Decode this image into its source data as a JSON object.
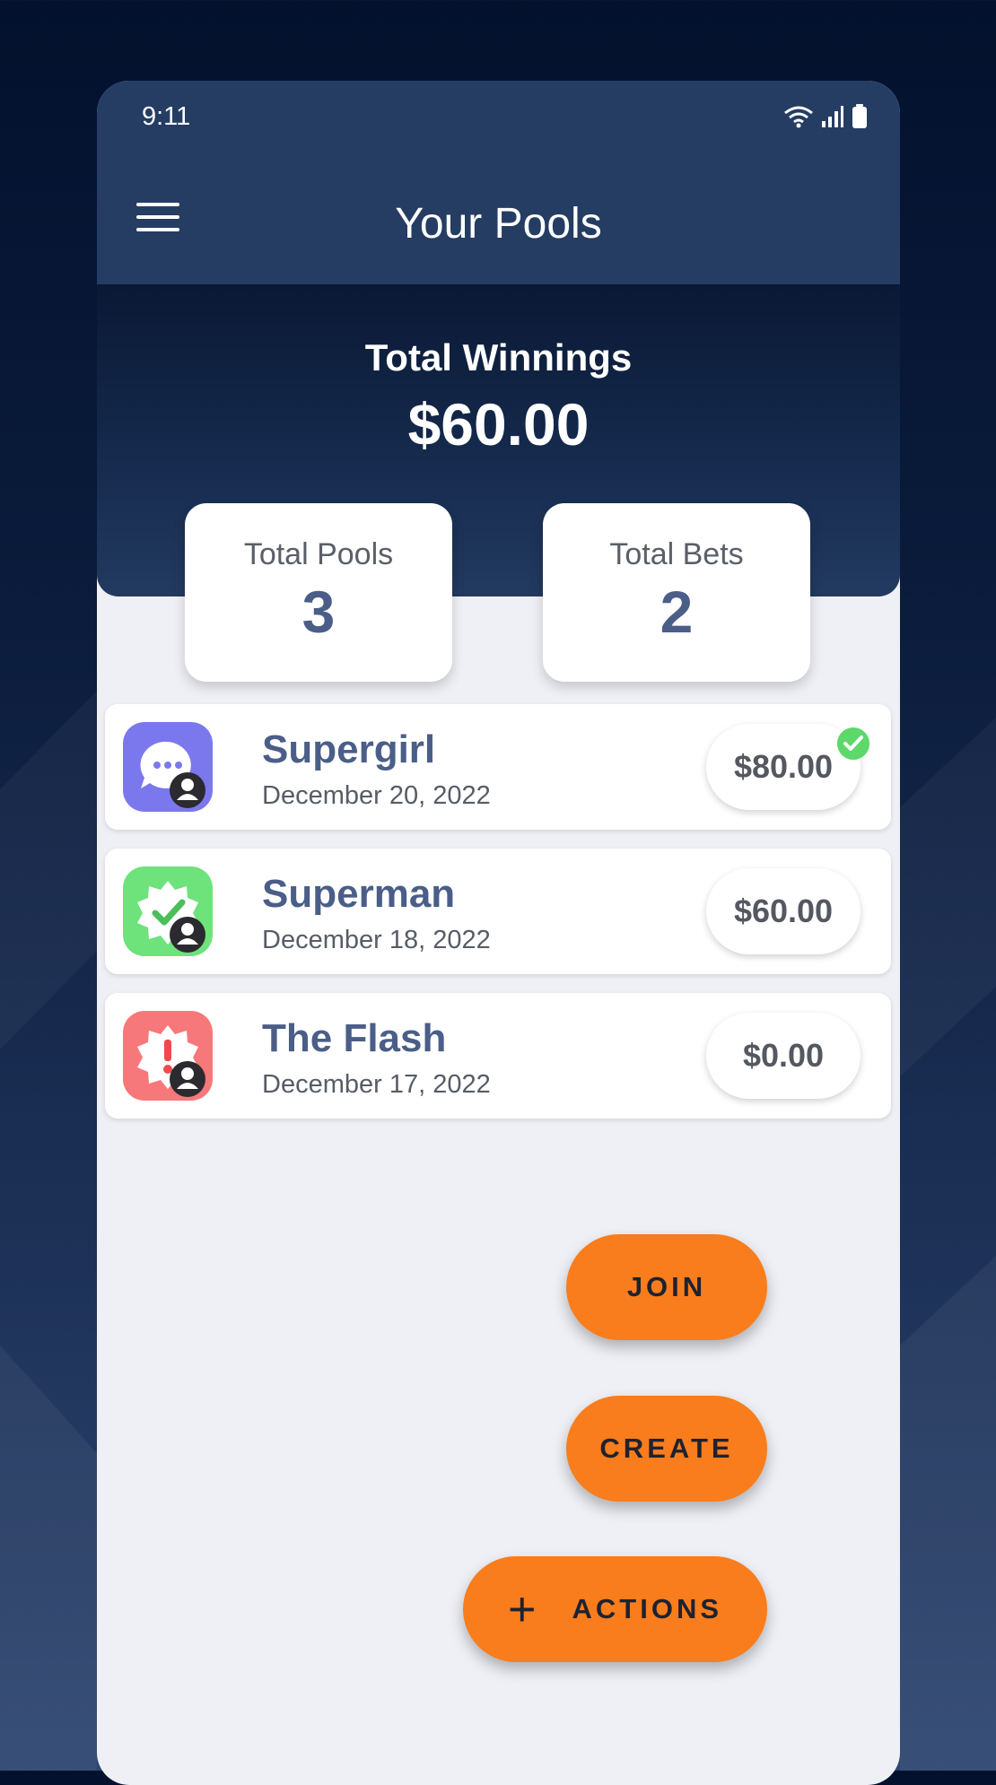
{
  "status_bar": {
    "time": "9:11"
  },
  "app_bar": {
    "title": "Your Pools",
    "menu_icon": "hamburger-menu-icon"
  },
  "summary": {
    "winnings_label": "Total Winnings",
    "winnings_value": "$60.00",
    "stats": [
      {
        "label": "Total Pools",
        "value": "3"
      },
      {
        "label": "Total Bets",
        "value": "2"
      }
    ]
  },
  "pools": [
    {
      "name": "Supergirl",
      "date": "December 20, 2022",
      "amount": "$80.00",
      "icon": "chat-bubble-icon",
      "icon_color": "#7b78ee",
      "checked": true
    },
    {
      "name": "Superman",
      "date": "December 18, 2022",
      "amount": "$60.00",
      "icon": "verified-badge-icon",
      "icon_color": "#6ee27b",
      "checked": false
    },
    {
      "name": "The Flash",
      "date": "December 17, 2022",
      "amount": "$0.00",
      "icon": "alert-badge-icon",
      "icon_color": "#f7787a",
      "checked": false
    }
  ],
  "actions": {
    "join": "JOIN",
    "create": "CREATE",
    "actions": "ACTIONS",
    "plus": "+"
  },
  "colors": {
    "accent": "#f97d1c",
    "header": "#253d62",
    "text_primary": "#4a5e88"
  }
}
